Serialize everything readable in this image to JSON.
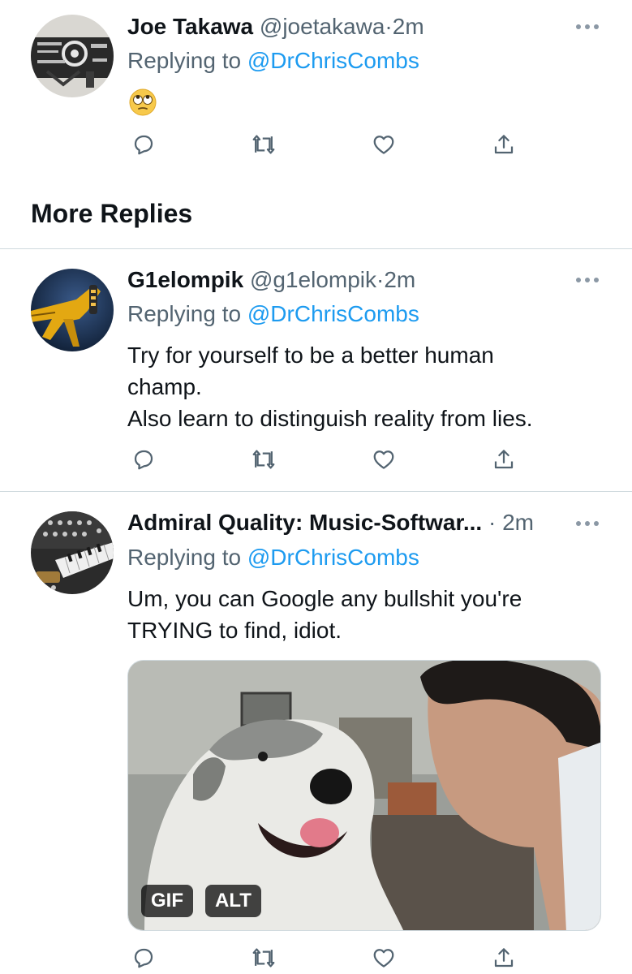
{
  "tweets": [
    {
      "name": "Joe Takawa",
      "handle": "@joetakawa",
      "separator": "·",
      "time": "2m",
      "replying_label": "Replying to ",
      "replying_mention": "@DrChrisCombs",
      "emoji": "face-with-rolling-eyes",
      "avatar": "mechanical-parts-avatar"
    },
    {
      "name": "G1elompik",
      "handle": "@g1elompik",
      "separator": "·",
      "time": "2m",
      "replying_label": "Replying to ",
      "replying_mention": "@DrChrisCombs",
      "body_lines": [
        "Try for yourself to be a better human",
        "champ.",
        "Also learn to distinguish reality from lies."
      ],
      "avatar": "yellow-robot-dog-avatar"
    },
    {
      "name": "Admiral Quality: Music-Softwar...",
      "separator": "·",
      "time": "2m",
      "replying_label": "Replying to ",
      "replying_mention": "@DrChrisCombs",
      "body_lines": [
        "Um, you can Google any bullshit you're",
        "TRYING to find, idiot."
      ],
      "media": {
        "type": "gif",
        "description_icon": "dog-and-man-gif",
        "gif_badge": "GIF",
        "alt_badge": "ALT"
      },
      "avatar": "synthesizer-avatar"
    }
  ],
  "section": {
    "heading": "More Replies"
  },
  "colors": {
    "link": "#1d9bf0",
    "secondary_text": "#536471",
    "primary_text": "#0f1419",
    "divider": "#cfd9de"
  },
  "icons": {
    "reply": "reply-icon",
    "retweet": "retweet-icon",
    "like": "heart-icon",
    "share": "share-icon",
    "more": "more-options-icon"
  }
}
